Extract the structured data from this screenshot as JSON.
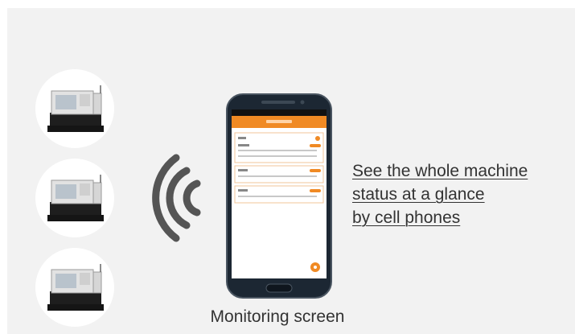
{
  "headline": {
    "line1": "See the whole machine",
    "line2": "status at a glance",
    "line3": "by cell phones"
  },
  "caption": "Monitoring screen",
  "icons": {
    "machines": [
      "cnc-machine-icon",
      "cnc-machine-icon",
      "cnc-machine-icon"
    ],
    "signal": "wireless-signal-icon",
    "phone": "smartphone-icon"
  },
  "colors": {
    "accent": "#f08a24",
    "panel": "#f2f2f2",
    "text": "#333333",
    "signal": "#555555"
  }
}
